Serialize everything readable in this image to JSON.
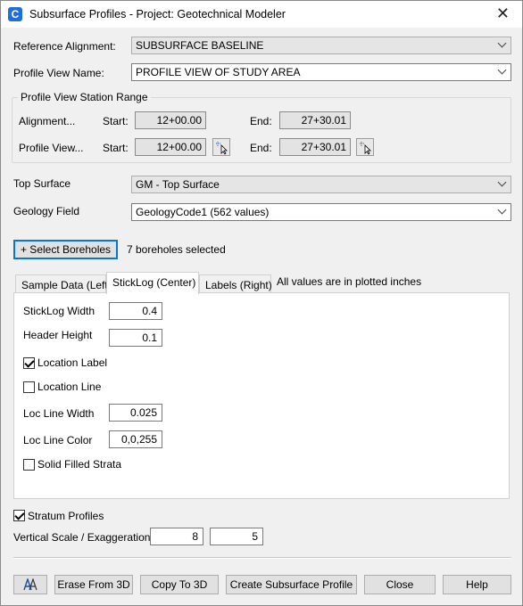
{
  "window": {
    "title": "Subsurface Profiles - Project: Geotechnical Modeler",
    "app_icon_letter": "C",
    "close_glyph": "✕"
  },
  "reference_alignment": {
    "label": "Reference Alignment:",
    "value": "SUBSURFACE BASELINE"
  },
  "profile_view_name": {
    "label": "Profile View Name:",
    "value": "PROFILE VIEW OF STUDY AREA"
  },
  "station_range": {
    "title": "Profile View Station Range",
    "alignment": {
      "label": "Alignment...",
      "start_label": "Start:",
      "start": "12+00.00",
      "end_label": "End:",
      "end": "27+30.01"
    },
    "profile_view": {
      "label": "Profile View...",
      "start_label": "Start:",
      "start": "12+00.00",
      "end_label": "End:",
      "end": "27+30.01"
    }
  },
  "top_surface": {
    "label": "Top Surface",
    "value": "GM - Top Surface"
  },
  "geology_field": {
    "label": "Geology Field",
    "value": "GeologyCode1 (562 values)"
  },
  "boreholes": {
    "button_label": "+ Select Boreholes",
    "status": "7 boreholes selected"
  },
  "tabs": [
    {
      "label": "Sample Data (Left)",
      "active": false
    },
    {
      "label": "StickLog (Center)",
      "active": true
    },
    {
      "label": "Labels (Right)",
      "active": false
    }
  ],
  "tabs_note": "All values are in plotted inches",
  "sticklog": {
    "width": {
      "label": "StickLog Width",
      "value": "0.4"
    },
    "header_height": {
      "label": "Header Height",
      "value": "0.1"
    },
    "location_label": {
      "label": "Location Label",
      "checked": true
    },
    "location_line": {
      "label": "Location Line",
      "checked": false
    },
    "loc_line_width": {
      "label": "Loc Line Width",
      "value": "0.025"
    },
    "loc_line_color": {
      "label": "Loc Line Color",
      "value": "0,0,255"
    },
    "solid_filled_strata": {
      "label": "Solid Filled Strata",
      "checked": false
    }
  },
  "stratum_profiles": {
    "label": "Stratum Profiles",
    "checked": true
  },
  "vertical_scale": {
    "label": "Vertical Scale / Exaggeration:",
    "scale": "8",
    "exaggeration": "5"
  },
  "footer": {
    "text_style_icon": "text-style-icon",
    "erase_3d": "Erase From 3D",
    "copy_3d": "Copy To 3D",
    "create": "Create Subsurface Profile",
    "close": "Close",
    "help": "Help"
  }
}
